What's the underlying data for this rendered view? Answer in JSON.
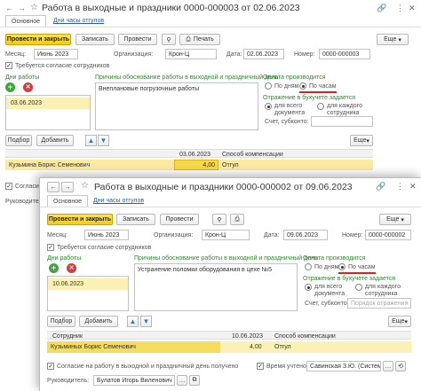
{
  "doc1": {
    "title": "Работа в выходные и праздники 0000-000003 от 02.06.2023",
    "tabs": [
      "Основное",
      "Дни часы отгулов"
    ],
    "buttons": {
      "post_close": "Провести и закрыть",
      "save": "Записать",
      "post": "Провести",
      "print": "Печать",
      "more": "Еще"
    },
    "month_label": "Месяц:",
    "month_value": "Июнь 2023",
    "org_label": "Организация:",
    "org_value": "Крон-Ц",
    "date_label": "Дата:",
    "date_value": "02.06.2023",
    "number_label": "Номер:",
    "number_value": "0000-000003",
    "consent_label": "Требуется согласие сотрудников",
    "workdays_label": "Дни работы",
    "reason_label": "Причины обоснование работы в выходной и праздничный день",
    "reason_value": "Внеплановые погрузочные работы",
    "payment_label": "Оплата производится",
    "by_days": "По дням",
    "by_hours": "По часам",
    "accounting_label": "Отражение в бухучете задается",
    "for_all": "для всего документа",
    "for_each": "для каждого сотрудника",
    "account_label": "Счет, субконто:",
    "workdays": [
      "03.06.2023"
    ],
    "fill_button": "Подбор",
    "add_button": "Добавить",
    "table_date_col": "03.06.2023",
    "table_comp_col": "Способ компенсации",
    "row": {
      "employee": "Кузьмина Борис Семенович",
      "hours": "4,00",
      "comp": "Отгул"
    },
    "footer_consent_partial": "Согласие",
    "footer_head_partial": "Руководитель"
  },
  "doc2": {
    "title": "Работа в выходные и праздники 0000-000002 от 09.06.2023",
    "tabs": [
      "Основное",
      "Дни часы отгулов"
    ],
    "buttons": {
      "post_close": "Провести и закрыть",
      "save": "Записать",
      "post": "Провести",
      "more": "Еще"
    },
    "month_label": "Месяц:",
    "month_value": "Июнь 2023",
    "org_label": "Организация:",
    "org_value": "Крон-Ц",
    "date_label": "Дата:",
    "date_value": "09.06.2023",
    "number_label": "Номер:",
    "number_value": "0000-000002",
    "consent_label": "Требуется согласие сотрудников",
    "workdays_label": "Дни работы",
    "reason_label": "Причины обоснование работы в выходной и праздничный день",
    "reason_value": "Устранение поломки оборудования в цехе №5",
    "payment_label": "Оплата производится",
    "by_days": "По дням",
    "by_hours": "По часам",
    "accounting_label": "Отражение в бухучете задается",
    "for_all": "для всего документа",
    "for_each": "для каждого сотрудника",
    "account_label": "Счет, субконто:",
    "account_placeholder": "Порядок отражения",
    "workdays": [
      "10.06.2023"
    ],
    "fill_button": "Подбор",
    "add_button": "Добавить",
    "table_emp_col": "Сотрудник",
    "table_date_col": "10.06.2023",
    "table_comp_col": "Способ компенсации",
    "row": {
      "employee": "Кузьминых Борис Семенович",
      "hours": "4,00",
      "comp": "Отгул"
    },
    "consent_received": "Согласие на работу в выходной и праздничный день получено",
    "time_label": "Время учтено",
    "time_value": "Савинская З.Ю. (Система",
    "head_label": "Руководитель:",
    "head_value": "Булатов Игорь Виленович"
  },
  "colors": {
    "accent_yellow": "#f5cc12",
    "link": "#2b5ea8",
    "section_green": "#2f8a2f",
    "underline_red": "#e02020",
    "row_highlight": "#fcf1b4"
  }
}
